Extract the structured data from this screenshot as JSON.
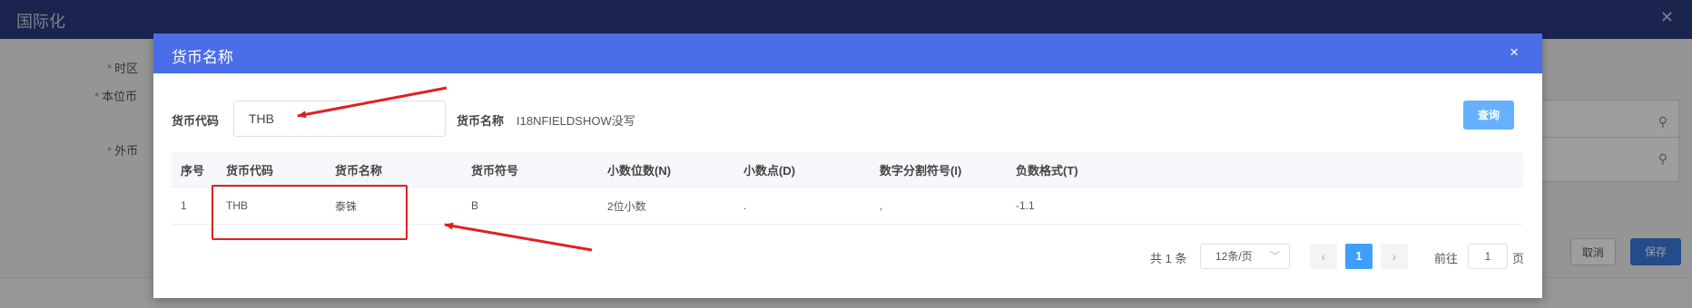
{
  "background": {
    "window_title": "国际化",
    "labels": {
      "timezone": "时区",
      "base_currency": "本位币",
      "foreign_currency": "外币"
    },
    "cancel_label": "取消",
    "save_label": "保存"
  },
  "modal": {
    "title": "货币名称",
    "close_icon": "×",
    "search": {
      "code_label": "货币代码",
      "code_value": "THB",
      "name_label": "货币名称",
      "name_value": "I18NFIELDSHOW没写",
      "query_label": "查询"
    },
    "table": {
      "headers": [
        "序号",
        "货币代码",
        "货币名称",
        "货币符号",
        "小数位数(N)",
        "小数点(D)",
        "数字分割符号(I)",
        "负数格式(T)"
      ],
      "rows": [
        [
          "1",
          "THB",
          "泰铢",
          "B",
          "2位小数",
          ".",
          ",",
          "-1.1"
        ]
      ]
    },
    "pagination": {
      "total": "共 1 条",
      "page_size": "12条/页",
      "prev_icon": "‹",
      "current_page": "1",
      "next_icon": "›",
      "goto_label": "前往",
      "goto_value": "1",
      "page_suffix": "页"
    }
  },
  "colors": {
    "modal_header": "#4a6ee8",
    "background_header": "#2a3b80",
    "annotation": "#e02020",
    "active_page": "#409eff"
  }
}
